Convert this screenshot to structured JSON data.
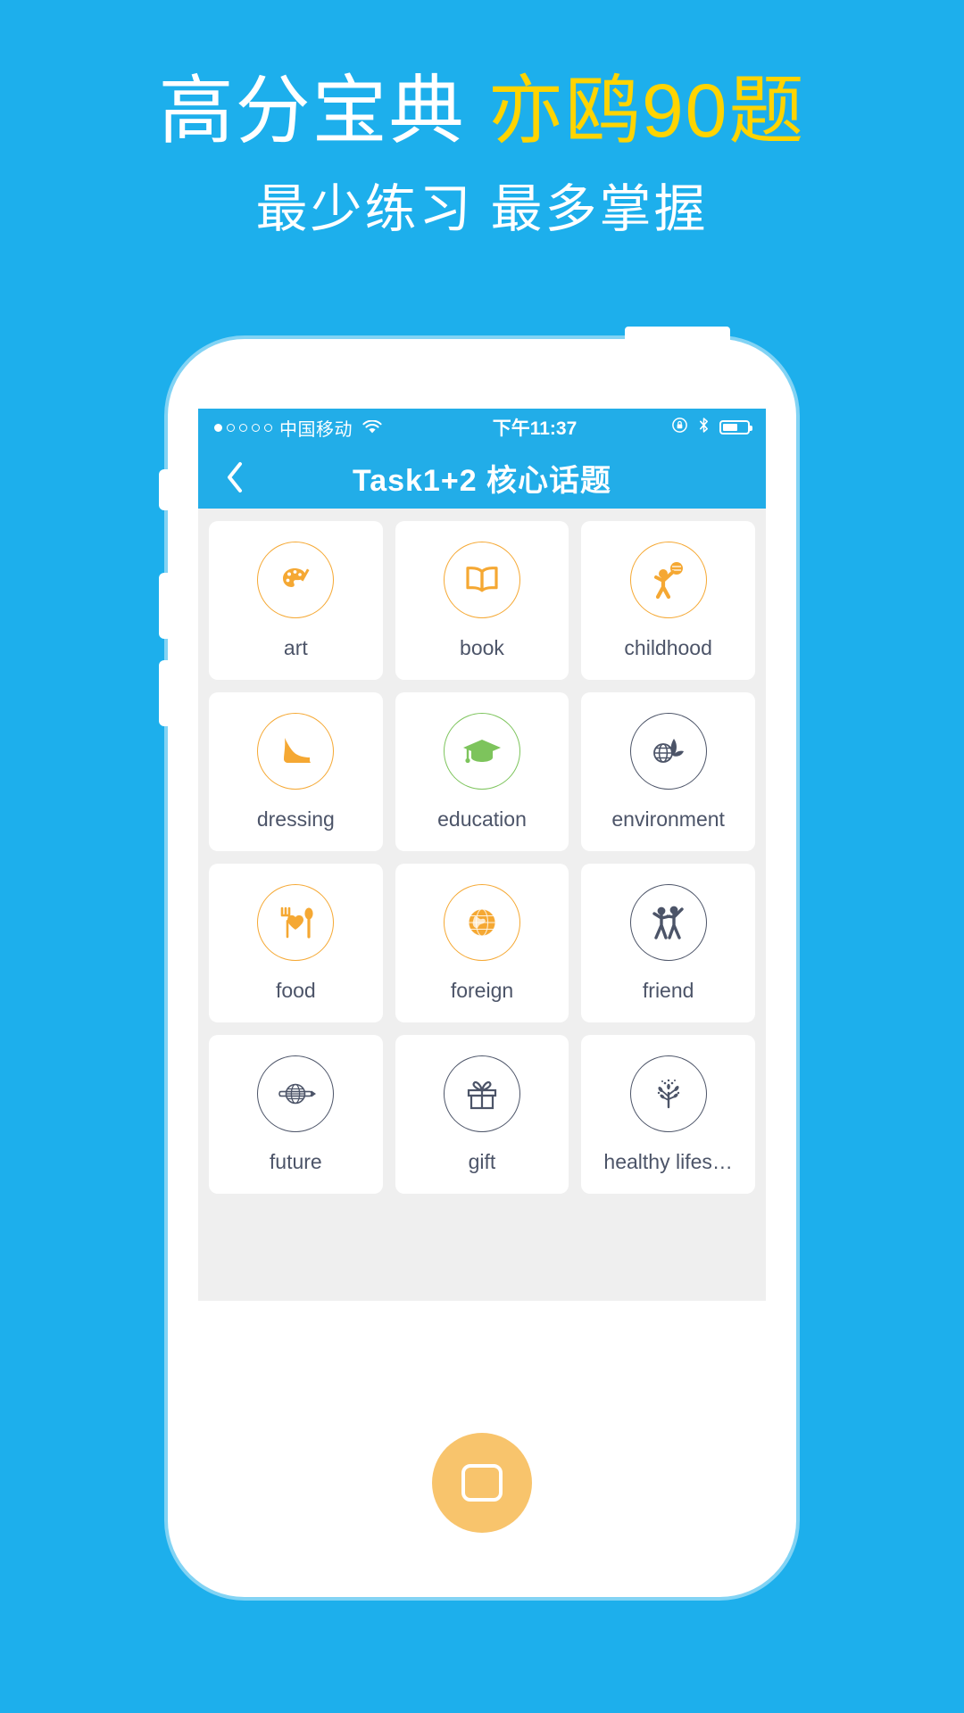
{
  "promo": {
    "headline_white": "高分宝典",
    "headline_accent": "亦鸥90题",
    "subhead": "最少练习 最多掌握",
    "accent_color": "#FFD400",
    "background_color": "#1DAFEC"
  },
  "phone": {
    "statusbar": {
      "signal_dots": "●○○○○",
      "carrier": "中国移动",
      "wifi_icon": "wifi-icon",
      "time": "下午11:37",
      "rotation_lock_icon": "rotation-lock-icon",
      "bluetooth_icon": "bluetooth-icon",
      "battery_icon": "battery-icon",
      "battery_percent": 62
    },
    "navbar": {
      "back_icon": "chevron-left-icon",
      "title": "Task1+2 核心话题",
      "bar_color": "#22ADE8"
    },
    "home_button": {
      "icon": "home-square-icon",
      "color": "#F8C46C"
    }
  },
  "topics": [
    {
      "label": "art",
      "icon": "palette-icon",
      "color": "orange"
    },
    {
      "label": "book",
      "icon": "open-book-icon",
      "color": "orange"
    },
    {
      "label": "childhood",
      "icon": "child-ball-icon",
      "color": "orange"
    },
    {
      "label": "dressing",
      "icon": "high-heel-icon",
      "color": "orange"
    },
    {
      "label": "education",
      "icon": "graduation-cap-icon",
      "color": "green"
    },
    {
      "label": "environment",
      "icon": "globe-leaf-icon",
      "color": "navy"
    },
    {
      "label": "food",
      "icon": "fork-heart-spoon-icon",
      "color": "orange"
    },
    {
      "label": "foreign",
      "icon": "globe-icon",
      "color": "orange"
    },
    {
      "label": "friend",
      "icon": "two-friends-icon",
      "color": "navy"
    },
    {
      "label": "future",
      "icon": "globe-ring-icon",
      "color": "navy"
    },
    {
      "label": "gift",
      "icon": "gift-box-icon",
      "color": "navy"
    },
    {
      "label": "healthy lifes…",
      "icon": "tree-sparkle-icon",
      "color": "navy"
    }
  ],
  "palette": {
    "orange": "#F5A833",
    "green": "#7DC45C",
    "navy": "#4C5468",
    "tile_bg": "#FFFFFF",
    "screen_bg": "#EFEFEF"
  }
}
